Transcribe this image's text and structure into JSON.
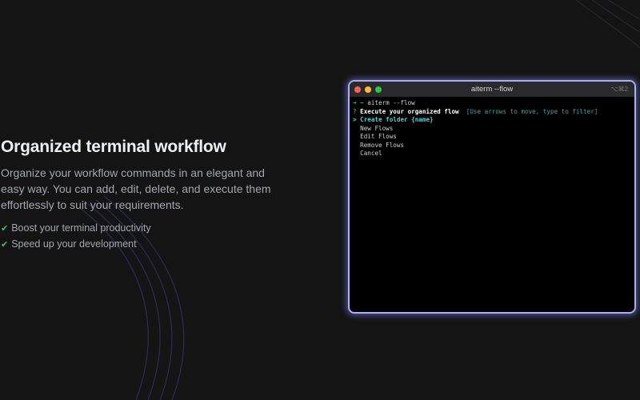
{
  "hero": {
    "title": "Organized terminal workflow",
    "description": "Organize your workflow commands in an elegant and easy way. You can add, edit, delete, and execute them effortlessly to suit your requirements.",
    "features": [
      "Boost your terminal productivity",
      "Speed up your development"
    ]
  },
  "terminal": {
    "title": "aiterm --flow",
    "shortcut": "⌥⌘2",
    "prompt_arrow": "➜",
    "command": " ~ aiterm --flow",
    "question_mark": "?",
    "question": "Execute your organized flow",
    "hint": "[Use arrows to move, type to filter]",
    "cursor": ">",
    "options": [
      "Create folder {name}",
      "New Flows",
      "Edit Flows",
      "Remove Flows",
      "Cancel"
    ]
  },
  "colors": {
    "accent": "#a9aef5",
    "check": "#3fc26a",
    "selected": "#4fd1d9"
  }
}
